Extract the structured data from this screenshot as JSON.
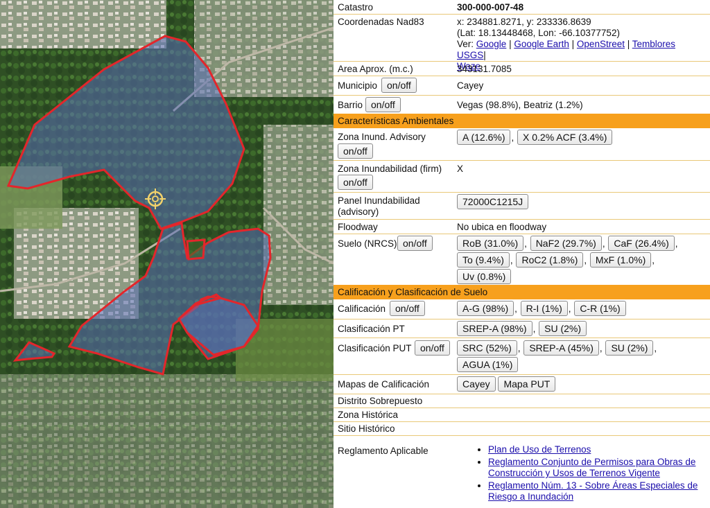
{
  "map": {
    "marker_icon": "crosshair-target-icon",
    "parcel_color": "#e3262b",
    "overlay_color": "#5a6fb8"
  },
  "info": {
    "catastro_label": "Catastro",
    "catastro_value": "300-000-007-48",
    "coords_label": "Coordenadas Nad83",
    "coords_xy": "x: 234881.8271, y: 233336.8639",
    "coords_latlon": "(Lat: 18.13448468, Lon: -66.10377752)",
    "ver_label": "Ver:",
    "links": [
      "Google",
      "Google Earth",
      "OpenStreet",
      "Temblores USGS",
      "Waze"
    ],
    "area_label": "Area Aprox. (m.c.)",
    "area_value": "343131.7085",
    "municipio_label": "Municipio",
    "municipio_value": "Cayey",
    "barrio_label": "Barrio",
    "barrio_value": "Vegas (98.8%), Beatriz (1.2%)",
    "onoff": "on/off"
  },
  "ambientales": {
    "title": "Características Ambientales",
    "zona_inund_adv_label": "Zona Inund. Advisory",
    "zona_inund_adv_values": [
      "A (12.6%)",
      "X 0.2% ACF (3.4%)"
    ],
    "zona_inund_firm_label": "Zona Inundabilidad (firm)",
    "zona_inund_firm_value": "X",
    "panel_label_1": "Panel Inundabilidad",
    "panel_label_2": "(advisory)",
    "panel_value": "72000C1215J",
    "floodway_label": "Floodway",
    "floodway_value": "No ubica en floodway",
    "suelo_label": "Suelo (NRCS)",
    "suelo_values": [
      "RoB (31.0%)",
      "NaF2 (29.7%)",
      "CaF (26.4%)",
      "To (9.4%)",
      "RoC2 (1.8%)",
      "MxF (1.0%)",
      "Uv (0.8%)"
    ]
  },
  "calificacion": {
    "title": "Calificación y Clasificación de Suelo",
    "calificacion_label": "Calificación",
    "calificacion_values": [
      "A-G (98%)",
      "R-I (1%)",
      "C-R (1%)"
    ],
    "clas_pt_label": "Clasificación PT",
    "clas_pt_values": [
      "SREP-A (98%)",
      "SU (2%)"
    ],
    "clas_put_label": "Clasificación PUT",
    "clas_put_values": [
      "SRC (52%)",
      "SREP-A (45%)",
      "SU (2%)",
      "AGUA (1%)"
    ],
    "mapas_label": "Mapas de Calificación",
    "mapas_values": [
      "Cayey",
      "Mapa PUT"
    ],
    "distrito_label": "Distrito Sobrepuesto",
    "zona_hist_label": "Zona Histórica",
    "sitio_hist_label": "Sitio Histórico",
    "reglamento_label": "Reglamento Aplicable",
    "reglamentos": [
      "Plan de Uso de Terrenos",
      "Reglamento Conjunto de Permisos para Obras de Construcción y Usos de Terrenos Vigente",
      "Reglamento Núm. 13 - Sobre Áreas Especiales de Riesgo a Inundación"
    ]
  }
}
